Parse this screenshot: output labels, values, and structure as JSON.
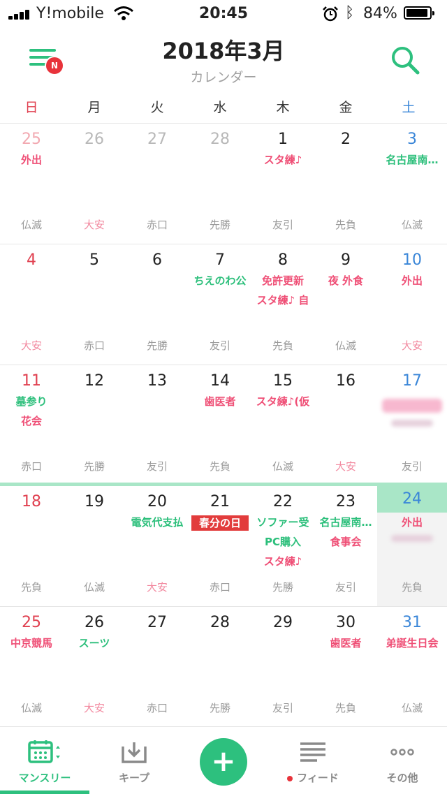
{
  "status_bar": {
    "carrier": "Y!mobile",
    "time": "20:45",
    "battery": "84%"
  },
  "header": {
    "title": "2018年3月",
    "subtitle": "カレンダー",
    "menu_badge": "N"
  },
  "weekdays": [
    "日",
    "月",
    "火",
    "水",
    "木",
    "金",
    "土"
  ],
  "weeks": [
    [
      {
        "num": "25",
        "events": [
          {
            "t": "外出",
            "c": "pink"
          }
        ],
        "rokuyo": "仏滅"
      },
      {
        "num": "26",
        "events": [],
        "rokuyo": "大安"
      },
      {
        "num": "27",
        "events": [],
        "rokuyo": "赤口"
      },
      {
        "num": "28",
        "events": [],
        "rokuyo": "先勝"
      },
      {
        "num": "1",
        "events": [
          {
            "t": "スタ練♪",
            "c": "pink"
          }
        ],
        "rokuyo": "友引"
      },
      {
        "num": "2",
        "events": [],
        "rokuyo": "先負"
      },
      {
        "num": "3",
        "events": [
          {
            "t": "名古屋南…",
            "c": "green"
          }
        ],
        "rokuyo": "仏滅"
      }
    ],
    [
      {
        "num": "4",
        "events": [],
        "rokuyo": "大安"
      },
      {
        "num": "5",
        "events": [],
        "rokuyo": "赤口"
      },
      {
        "num": "6",
        "events": [],
        "rokuyo": "先勝"
      },
      {
        "num": "7",
        "events": [
          {
            "t": "ちえのわ公",
            "c": "green"
          }
        ],
        "rokuyo": "友引"
      },
      {
        "num": "8",
        "events": [
          {
            "t": "免許更新",
            "c": "pink"
          },
          {
            "t": "スタ練♪ 自",
            "c": "pink"
          }
        ],
        "rokuyo": "先負"
      },
      {
        "num": "9",
        "events": [
          {
            "t": "夜 外食",
            "c": "pink"
          }
        ],
        "rokuyo": "仏滅"
      },
      {
        "num": "10",
        "events": [
          {
            "t": "外出",
            "c": "pink"
          }
        ],
        "rokuyo": "大安"
      }
    ],
    [
      {
        "num": "11",
        "events": [
          {
            "t": "墓参り",
            "c": "green"
          },
          {
            "t": "花会",
            "c": "pink"
          }
        ],
        "rokuyo": "赤口"
      },
      {
        "num": "12",
        "events": [],
        "rokuyo": "先勝"
      },
      {
        "num": "13",
        "events": [],
        "rokuyo": "友引"
      },
      {
        "num": "14",
        "events": [
          {
            "t": "歯医者",
            "c": "pink"
          }
        ],
        "rokuyo": "先負"
      },
      {
        "num": "15",
        "events": [
          {
            "t": "スタ練♪(仮",
            "c": "pink"
          }
        ],
        "rokuyo": "仏滅"
      },
      {
        "num": "16",
        "events": [],
        "rokuyo": "大安"
      },
      {
        "num": "17",
        "events": [],
        "rokuyo": "友引"
      }
    ],
    [
      {
        "num": "18",
        "events": [],
        "rokuyo": "先負"
      },
      {
        "num": "19",
        "events": [],
        "rokuyo": "仏滅"
      },
      {
        "num": "20",
        "events": [
          {
            "t": "電気代支払",
            "c": "green"
          }
        ],
        "rokuyo": "大安"
      },
      {
        "num": "21",
        "events": [
          {
            "t": "春分の日",
            "c": "red-bg"
          }
        ],
        "rokuyo": "赤口"
      },
      {
        "num": "22",
        "events": [
          {
            "t": "ソファー受",
            "c": "green"
          },
          {
            "t": "PC購入",
            "c": "green"
          },
          {
            "t": "スタ練♪",
            "c": "pink"
          }
        ],
        "rokuyo": "先勝"
      },
      {
        "num": "23",
        "events": [
          {
            "t": "名古屋南…",
            "c": "green"
          },
          {
            "t": "食事会",
            "c": "pink"
          }
        ],
        "rokuyo": "友引"
      },
      {
        "num": "24",
        "events": [
          {
            "t": "外出",
            "c": "pink"
          }
        ],
        "rokuyo": "先負"
      }
    ],
    [
      {
        "num": "25",
        "events": [
          {
            "t": "中京競馬",
            "c": "pink"
          }
        ],
        "rokuyo": "仏滅"
      },
      {
        "num": "26",
        "events": [
          {
            "t": "スーツ",
            "c": "green"
          }
        ],
        "rokuyo": "大安"
      },
      {
        "num": "27",
        "events": [],
        "rokuyo": "赤口"
      },
      {
        "num": "28",
        "events": [],
        "rokuyo": "先勝"
      },
      {
        "num": "29",
        "events": [],
        "rokuyo": "友引"
      },
      {
        "num": "30",
        "events": [
          {
            "t": "歯医者",
            "c": "pink"
          }
        ],
        "rokuyo": "先負"
      },
      {
        "num": "31",
        "events": [
          {
            "t": "弟誕生日会",
            "c": "pink"
          }
        ],
        "rokuyo": "仏滅"
      }
    ]
  ],
  "tabs": [
    {
      "label": "マンスリー",
      "icon": "calendar-icon",
      "active": true
    },
    {
      "label": "キープ",
      "icon": "inbox-download-icon",
      "active": false
    },
    {
      "label": "",
      "icon": "plus-icon",
      "active": false
    },
    {
      "label": "フィード",
      "icon": "feed-lines-icon",
      "active": false
    },
    {
      "label": "その他",
      "icon": "more-dots-icon",
      "active": false
    }
  ],
  "colors": {
    "accent": "#2dc07e",
    "pink": "#ef4f76",
    "sunday": "#e04050",
    "saturday": "#3a86d8",
    "holiday": "#e23c3c"
  }
}
